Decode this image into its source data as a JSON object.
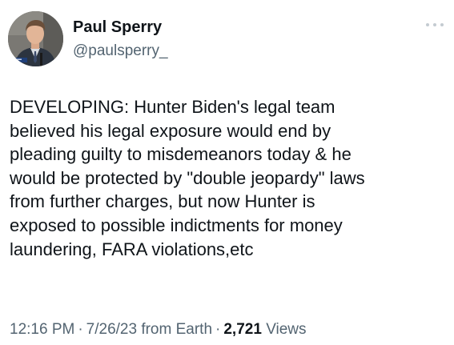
{
  "tweet": {
    "author": {
      "display_name": "Paul Sperry",
      "handle": "@paulsperry_"
    },
    "more_icon": "more-horizontal-icon",
    "text_lines": [
      "DEVELOPING: Hunter Biden's legal team",
      "believed his legal exposure would end by",
      "pleading guilty to misdemeanors today & he",
      "would be protected by \"double jeopardy\" laws",
      "from further charges, but now Hunter is",
      "exposed to possible indictments for money",
      "laundering, FARA violations,etc"
    ],
    "meta": {
      "time": "12:16 PM",
      "separator": "·",
      "date": "7/26/23 from Earth",
      "views_count": "2,721",
      "views_label": "Views"
    }
  },
  "colors": {
    "text_primary": "#0f1419",
    "text_secondary": "#536471",
    "background": "#ffffff"
  }
}
